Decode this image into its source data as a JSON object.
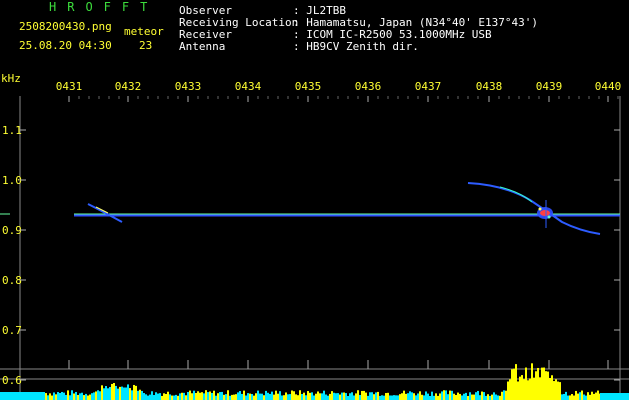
{
  "header": {
    "app_title": "HROFFT",
    "filename": "2508200430.png",
    "timestamp": "25.08.20 04:30",
    "meteor_label": "meteor",
    "meteor_count": "23",
    "info_labels": [
      "Observer",
      "Receiving Location",
      "Receiver",
      "Antenna"
    ],
    "info_values": [
      ": JL2TBB",
      ": Hamamatsu, Japan (N34°40' E137°43')",
      ": ICOM IC-R2500 53.1000MHz USB",
      ": HB9CV Zenith dir."
    ]
  },
  "axis": {
    "unit": "kHz",
    "time_ticks": [
      "0431",
      "0432",
      "0433",
      "0434",
      "0435",
      "0436",
      "0437",
      "0438",
      "0439",
      "0440"
    ],
    "freq_ticks": [
      "1.1",
      "1.0",
      "0.9",
      "0.8",
      "0.7",
      "0.6"
    ]
  },
  "colors": {
    "header_green": "#3cdc3c",
    "tick_yellow": "#ffff33",
    "trace_blue": "#2d5cff",
    "carrier_green": "#66ffa0",
    "histogram_yellow": "#ffff00",
    "histogram_cyan": "#00e5ff"
  }
}
